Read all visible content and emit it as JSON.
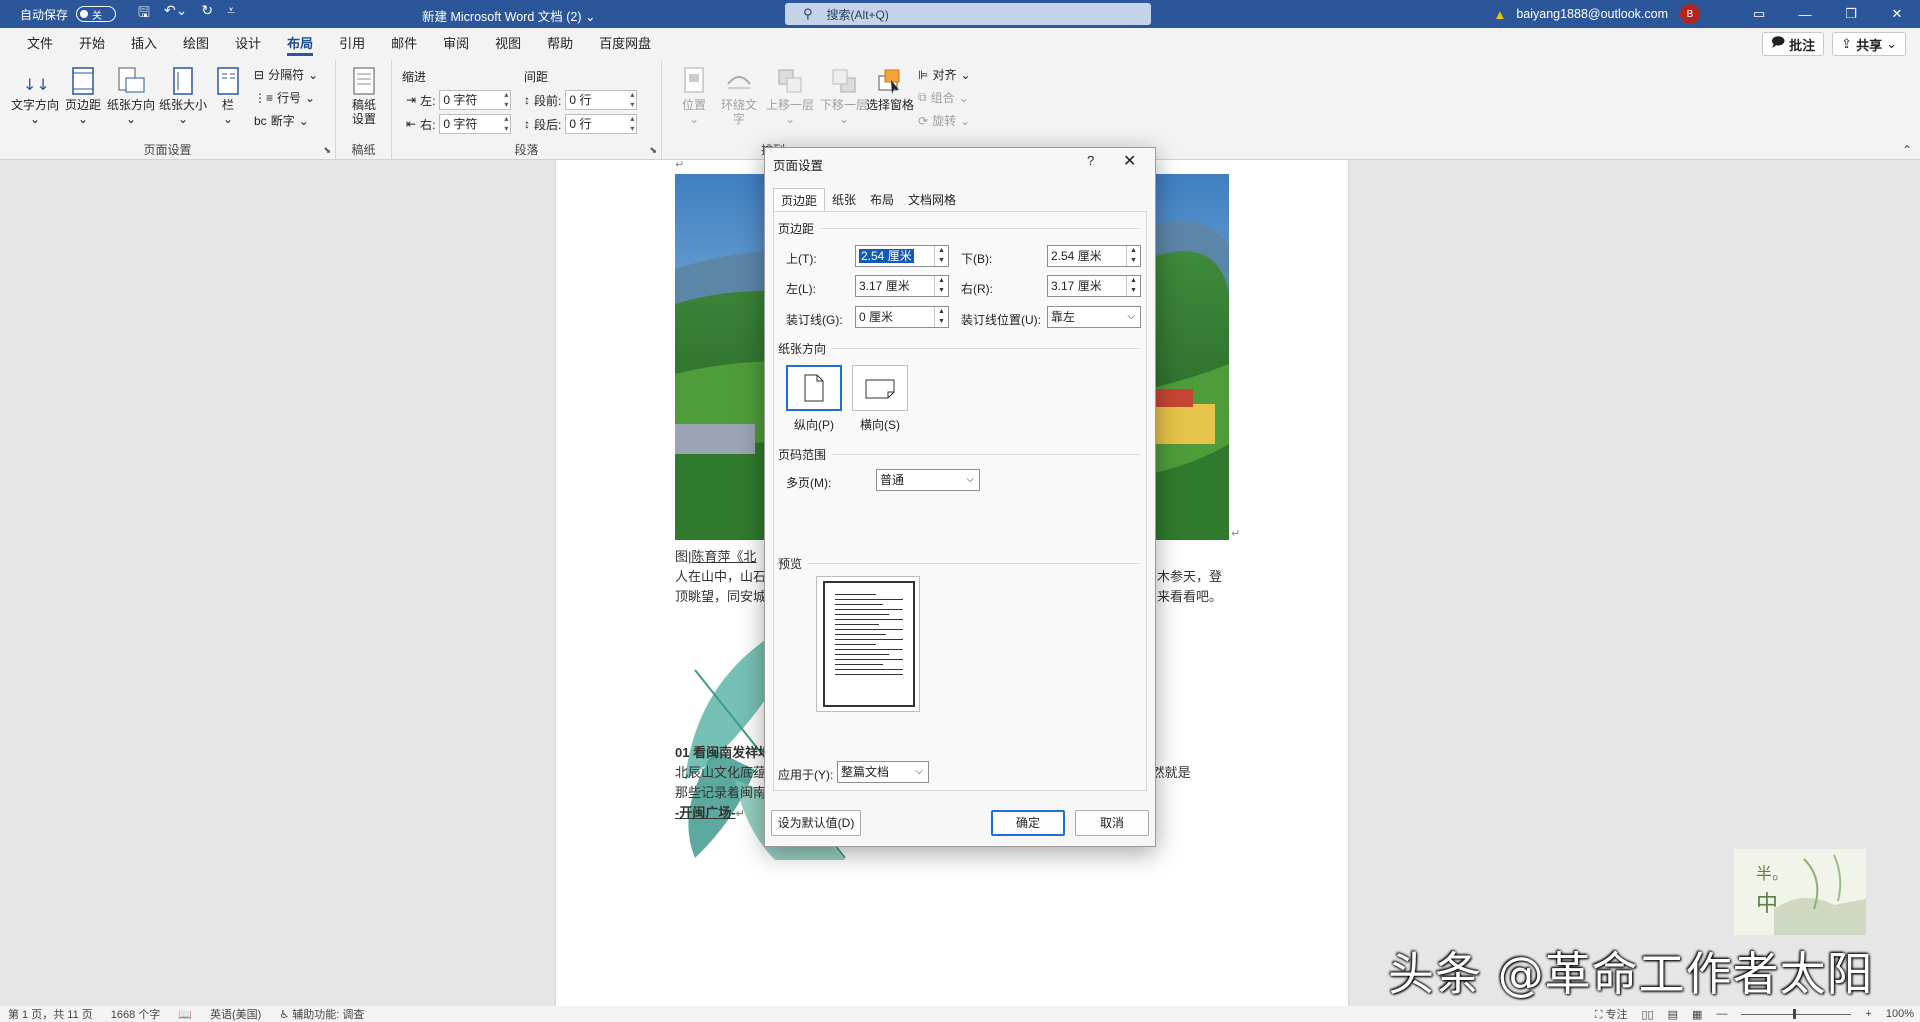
{
  "titlebar": {
    "autosave_label": "自动保存",
    "autosave_state": "关",
    "doc_title": "新建 Microsoft Word 文档 (2)",
    "search_placeholder": "搜索(Alt+Q)",
    "account": "baiyang1888@outlook.com",
    "avatar_initial": "B"
  },
  "ribbon_tabs": [
    "文件",
    "开始",
    "插入",
    "绘图",
    "设计",
    "布局",
    "引用",
    "邮件",
    "审阅",
    "视图",
    "帮助",
    "百度网盘"
  ],
  "active_tab": "布局",
  "ribbon_right": {
    "comments": "批注",
    "share": "共享"
  },
  "ribbon": {
    "page_setup": {
      "label": "页面设置",
      "text_direction": "文字方向",
      "margins": "页边距",
      "orientation": "纸张方向",
      "size": "纸张大小",
      "columns": "栏",
      "breaks": "分隔符",
      "line_numbers": "行号",
      "hyphenation": "断字"
    },
    "manuscript": {
      "label": "稿纸",
      "button_line1": "稿纸",
      "button_line2": "设置"
    },
    "paragraph": {
      "label": "段落",
      "indent_title": "缩进",
      "spacing_title": "间距",
      "left_label": "左:",
      "left_value": "0 字符",
      "right_label": "右:",
      "right_value": "0 字符",
      "before_label": "段前:",
      "before_value": "0 行",
      "after_label": "段后:",
      "after_value": "0 行"
    },
    "arrange": {
      "label": "排列",
      "position": "位置",
      "wrap_line1": "环绕文",
      "wrap_line2": "字",
      "bring_forward": "上移一层",
      "send_backward": "下移一层",
      "selection_pane": "选择窗格",
      "align": "对齐",
      "group": "组合",
      "rotate": "旋转"
    }
  },
  "document": {
    "caption_prefix": "图|",
    "caption_link": "陈育萍《北",
    "line1_left": "人在山中，山石",
    "line1_right": "木参天，登",
    "line2_left": "顶眺望，同安城",
    "line2_right": "来看看吧。",
    "heading": "01  看闽南发祥地",
    "body1": "北辰山文化底蕴深厚，人们常说“先有北山，后有同安”，来北辰山最不可错过的，当然就是",
    "body2": "那些记录着闽南悠久历史的人文景点。",
    "subheading": "-开闽广场-"
  },
  "statusbar": {
    "page": "第 1 页，共 11 页",
    "words": "1668 个字",
    "language": "英语(美国)",
    "accessibility": "辅助功能: 调查",
    "focus": "专注",
    "zoom": "100%"
  },
  "watermark": {
    "text": "头条 @革命工作者太阳",
    "badge_line1": "半。",
    "badge_line2": "中"
  },
  "dialog": {
    "title": "页面设置",
    "help": "?",
    "close": "✕",
    "tabs": [
      "页边距",
      "纸张",
      "布局",
      "文档网格"
    ],
    "active_tab": "页边距",
    "margins_section": "页边距",
    "top_label": "上(T):",
    "top_value": "2.54 厘米",
    "bottom_label": "下(B):",
    "bottom_value": "2.54 厘米",
    "left_label": "左(L):",
    "left_value": "3.17 厘米",
    "right_label": "右(R):",
    "right_value": "3.17 厘米",
    "gutter_label": "装订线(G):",
    "gutter_value": "0 厘米",
    "gutter_pos_label": "装订线位置(U):",
    "gutter_pos_value": "靠左",
    "orientation_section": "纸张方向",
    "portrait_label": "纵向(P)",
    "landscape_label": "横向(S)",
    "pages_section": "页码范围",
    "multiple_pages_label": "多页(M):",
    "multiple_pages_value": "普通",
    "preview_section": "预览",
    "apply_to_label": "应用于(Y):",
    "apply_to_value": "整篇文档",
    "set_default": "设为默认值(D)",
    "ok": "确定",
    "cancel": "取消"
  }
}
